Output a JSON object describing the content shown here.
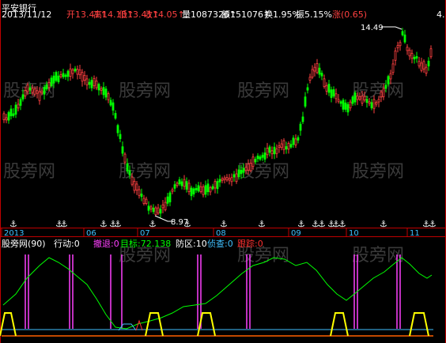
{
  "title_bar": {
    "name": "平安银行",
    "date": "2013/11/12",
    "items": [
      {
        "label": "开",
        "value": "13.41",
        "arrow": "↑",
        "color": "#ff4040"
      },
      {
        "label": "高",
        "value": "14.10",
        "arrow": "↑",
        "color": "#ff4040"
      },
      {
        "label": "低",
        "value": "13.41",
        "arrow": "↑",
        "color": "#ff4040"
      },
      {
        "label": "收",
        "value": "14.05",
        "arrow": "↑",
        "color": "#ff4040"
      },
      {
        "label": "量",
        "value": "1087326",
        "arrow": "↑",
        "color": "#ffffff"
      },
      {
        "label": "额",
        "value": "151076",
        "arrow": "↑",
        "color": "#ffffff"
      },
      {
        "label": "换",
        "value": "1.95%",
        "arrow": "",
        "color": "#ffffff"
      },
      {
        "label": "振",
        "value": "5.15%",
        "arrow": "",
        "color": "#ffffff"
      },
      {
        "label": "涨",
        "value": "(0.65)",
        "arrow": "",
        "color": "#ff4040"
      },
      {
        "label": "",
        "value": "4.",
        "arrow": "",
        "color": "#ffffff"
      }
    ]
  },
  "annotations": {
    "high": "14.49",
    "low": "8.97"
  },
  "x_axis": [
    "2013",
    "06",
    "07",
    "08",
    "09",
    "10",
    "11"
  ],
  "watermark": "股旁网",
  "indicator_bar": {
    "name": "股旁网(90)",
    "items": [
      {
        "label": "行动:",
        "value": "0",
        "color": "#ffffff"
      },
      {
        "label": "撤退:",
        "value": "0",
        "color": "#ff40ff"
      },
      {
        "label": "目标:",
        "value": "72.138",
        "color": "#00ff00"
      },
      {
        "label": "防区:",
        "value": "10",
        "color": "#ffffff"
      },
      {
        "label": "侦查:",
        "value": "0",
        "color": "#40c0ff"
      },
      {
        "label": "跟踪:",
        "value": "0",
        "color": "#ff3030"
      }
    ]
  },
  "colors": {
    "up": "#ff4040",
    "down": "#00ff00",
    "frame": "#c00000",
    "indicator_line": "#00ff00",
    "retreat_bar": "#ff40ff",
    "yellow": "#ffff00",
    "bottom_line": "#ff6000"
  },
  "icons": {
    "signal_marker": "anchor-down-arrow-icon"
  }
}
